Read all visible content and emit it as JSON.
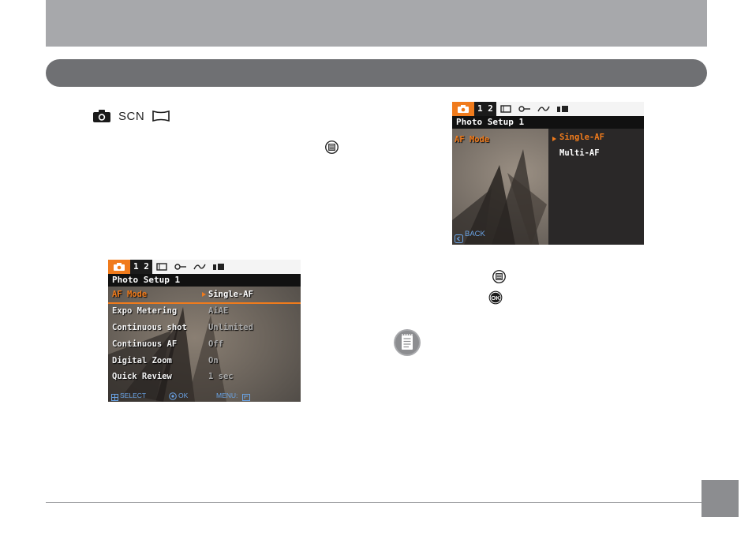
{
  "mode_icons": {
    "scn_label": "SCN",
    "icons": [
      "camera-icon",
      "scn-label",
      "panorama-icon",
      "menu-button-icon"
    ]
  },
  "screen_left": {
    "tab_page": "1 2",
    "title": "Photo Setup 1",
    "rows": [
      {
        "label": "AF Mode",
        "value": "Single-AF",
        "selected": true
      },
      {
        "label": "Expo Metering",
        "value": "AiAE",
        "selected": false
      },
      {
        "label": "Continuous shot",
        "value": "Unlimited",
        "selected": false
      },
      {
        "label": "Continuous AF",
        "value": "Off",
        "selected": false
      },
      {
        "label": "Digital Zoom",
        "value": "On",
        "selected": false
      },
      {
        "label": "Quick Review",
        "value": "1 sec",
        "selected": false
      }
    ],
    "footer": {
      "select": "SELECT",
      "ok": "OK",
      "menu": "MENU:"
    }
  },
  "screen_right": {
    "tab_page": "1 2",
    "title": "Photo Setup 1",
    "label": "AF Mode",
    "options": [
      "Single-AF",
      "Multi-AF"
    ],
    "back": "BACK"
  },
  "right_icons": [
    "menu-button-icon",
    "ok-button-icon",
    "note-icon"
  ],
  "colors": {
    "accent_orange": "#f07b1c",
    "header_gray": "#a7a8ab",
    "section_bar": "#6f7073",
    "page_box": "#8c8d90"
  }
}
